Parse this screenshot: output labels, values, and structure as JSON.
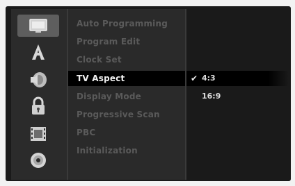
{
  "sidebar": {
    "icons": [
      "tv-screen-icon",
      "language-icon",
      "audio-speaker-icon",
      "lock-icon",
      "film-icon",
      "disc-icon"
    ]
  },
  "menu": {
    "items": [
      {
        "label": "Auto Programming"
      },
      {
        "label": "Program Edit"
      },
      {
        "label": "Clock Set"
      },
      {
        "label": "TV Aspect"
      },
      {
        "label": "Display Mode"
      },
      {
        "label": "Progressive Scan"
      },
      {
        "label": "PBC"
      },
      {
        "label": "Initialization"
      }
    ],
    "selected_index": 3
  },
  "options": {
    "items": [
      {
        "label": "4:3"
      },
      {
        "label": "16:9"
      }
    ],
    "selected_index": 0,
    "check_glyph": "✔"
  }
}
